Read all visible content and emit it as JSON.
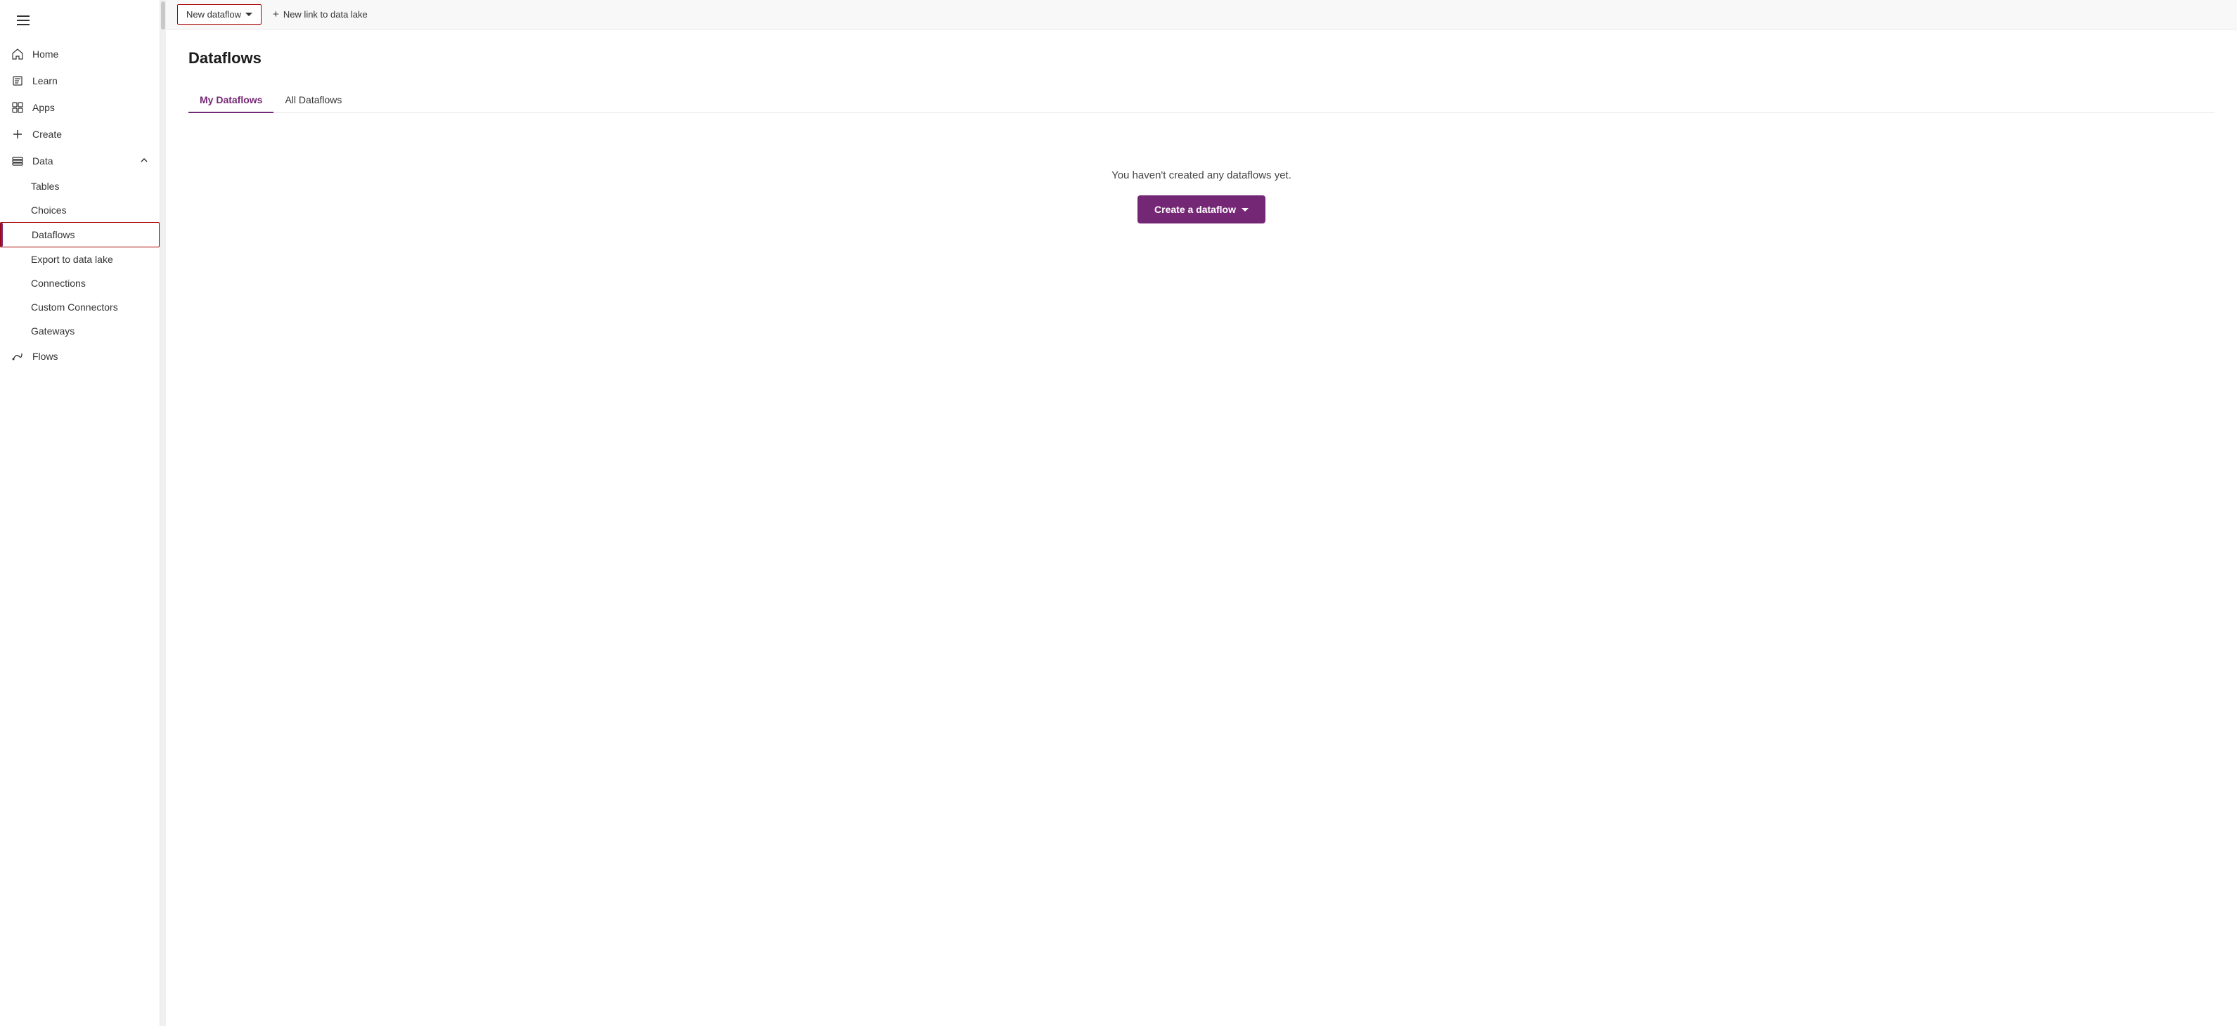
{
  "sidebar": {
    "menu_icon": "☰",
    "items": [
      {
        "id": "home",
        "label": "Home",
        "icon": "home"
      },
      {
        "id": "learn",
        "label": "Learn",
        "icon": "book"
      },
      {
        "id": "apps",
        "label": "Apps",
        "icon": "apps"
      },
      {
        "id": "create",
        "label": "Create",
        "icon": "plus"
      },
      {
        "id": "data",
        "label": "Data",
        "icon": "data",
        "expandable": true,
        "expanded": true
      }
    ],
    "sub_items": [
      {
        "id": "tables",
        "label": "Tables"
      },
      {
        "id": "choices",
        "label": "Choices"
      },
      {
        "id": "dataflows",
        "label": "Dataflows",
        "active": true
      },
      {
        "id": "export-to-data-lake",
        "label": "Export to data lake"
      },
      {
        "id": "connections",
        "label": "Connections"
      },
      {
        "id": "custom-connectors",
        "label": "Custom Connectors"
      },
      {
        "id": "gateways",
        "label": "Gateways"
      }
    ],
    "bottom_items": [
      {
        "id": "flows",
        "label": "Flows",
        "icon": "flows"
      }
    ]
  },
  "toolbar": {
    "new_dataflow_label": "New dataflow",
    "new_link_label": "New link to data lake"
  },
  "main": {
    "page_title": "Dataflows",
    "tabs": [
      {
        "id": "my-dataflows",
        "label": "My Dataflows",
        "active": true
      },
      {
        "id": "all-dataflows",
        "label": "All Dataflows",
        "active": false
      }
    ],
    "empty_state": {
      "text": "You haven't created any dataflows yet.",
      "create_button_label": "Create a dataflow"
    }
  }
}
